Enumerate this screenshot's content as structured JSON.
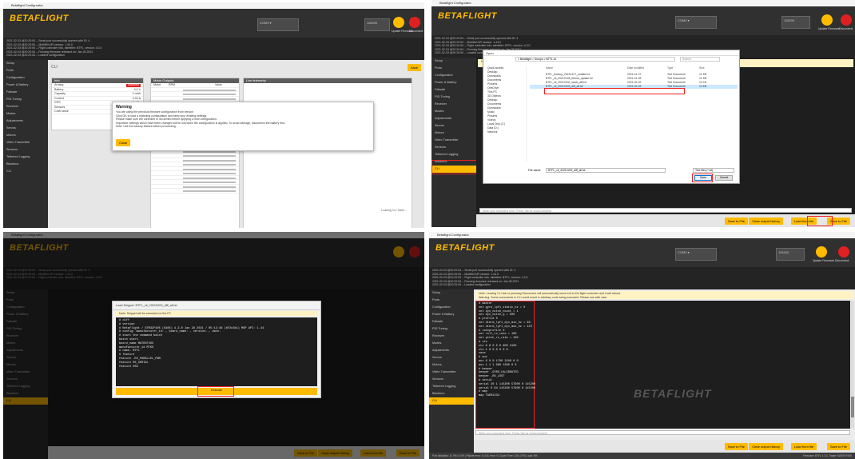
{
  "common": {
    "brand": "BETAFLIGHT",
    "window_title": "Betaflight Configurator",
    "update_label": "Update Firmware",
    "disconnect_label": "Disconnect",
    "colors": {
      "accent": "#ffbb00",
      "header": "#303030",
      "update": "#ffbb00",
      "disconnect": "#e02020"
    },
    "icons": [
      "usb-icon",
      "gear-icon",
      "plug-icon",
      "folder-icon"
    ]
  },
  "panel1": {
    "log_lines": [
      "2021-02-03 @20:20:54 -- Serial port successfully opened with ID: 4",
      "2021-02-03 @20:20:54 -- MultiWii API version: 1.44.0",
      "2021-02-03 @20:20:54 -- Flight controller info, identifier: BTFL, version: 4.3.0",
      "2021-02-03 @20:20:54 -- Running firmware released on: Jan 28 2021",
      "2021-02-03 @20:20:54 -- Loaded configuration"
    ],
    "sidebar": [
      "Setup",
      "Ports",
      "Configuration",
      "Power & Battery",
      "Failsafe",
      "PID Tuning",
      "Receiver",
      "Modes",
      "Adjustments",
      "Servos",
      "Motors",
      "Video Transmitter",
      "Sensors",
      "Tethered Logging",
      "Blackbox",
      "CLI"
    ],
    "section_title": "CLI",
    "top_button": "Save",
    "left_table_title": "Info",
    "left_table_rows": [
      [
        "Arming",
        "Disabled"
      ],
      [
        "Battery",
        "0.0 V"
      ],
      [
        "Capacity",
        "0 mAh"
      ],
      [
        "Current",
        "0.00 A"
      ],
      [
        "GPS",
        "No Fix"
      ],
      [
        "Sensors",
        "OK"
      ],
      [
        "Craft name",
        ""
      ]
    ],
    "mid_table_title": "Motor Outputs",
    "mid_table_head": [
      "Motor",
      "RPM",
      "Value"
    ],
    "right_table_title": "Live telemetry",
    "dialog": {
      "title": "Warning",
      "line1": "You are using the previous firmware configuration from version",
      "line2": "Click OK to load a matching configuration and keep your existing settings.",
      "line3": "Please make sure the controller is not armed before applying a new configuration.",
      "line4": "Important: settings which have been changed will be lost when the configuration is applied. To avoid damage, disconnect the battery first.",
      "line5": "Note: Use the backup feature before proceeding.",
      "button": "Close"
    },
    "bottom_right_label": "Loading CLI Table..."
  },
  "panel2": {
    "sidebar": [
      "Setup",
      "Ports",
      "Configuration",
      "Power & Battery",
      "Failsafe",
      "PID Tuning",
      "Receiver",
      "Modes",
      "Adjustments",
      "Servos",
      "Motors",
      "Video Transmitter",
      "Sensors",
      "Tethered Logging",
      "Blackbox",
      "CLI"
    ],
    "file_dialog": {
      "title": "Open",
      "path": "> Betaflight > Dumps > BTFL cli",
      "search": "Search",
      "nav": [
        "Quick access",
        "Desktop",
        "Downloads",
        "Documents",
        "Pictures",
        "OneDrive",
        "This PC",
        "3D Objects",
        "Desktop",
        "Documents",
        "Downloads",
        "Music",
        "Pictures",
        "Videos",
        "Local Disk (C:)",
        "Data (D:)",
        "Network"
      ],
      "columns": [
        "Name",
        "Date modified",
        "Type",
        "Size"
      ],
      "files": [
        [
          "BTFL_backup_20210127_nodate.txt",
          "2021-01-27",
          "Text Document",
          "12 KB"
        ],
        [
          "BTFL_cli_20210128_before_update.txt",
          "2021-01-28",
          "Text Document",
          "12 KB"
        ],
        [
          "BTFL_cli_20210202_stock_diff.txt",
          "2021-02-02",
          "Text Document",
          "11 KB"
        ],
        [
          "BTFL_cli_20210203_diff_all.txt",
          "2021-02-03",
          "Text Document",
          "12 KB"
        ]
      ],
      "filename_label": "File name:",
      "filename_value": "BTFL_cli_20210203_diff_all.txt",
      "filter": "Text files (*.txt)",
      "open_button": "Open",
      "cancel_button": "Cancel"
    },
    "left_list": [
      "Name",
      "Betaflight backup",
      "Dumps"
    ],
    "bottom_buttons": [
      "Save to File",
      "Clear output history",
      "Load from file",
      "Save to File"
    ],
    "input_placeholder": "Write your command here. Press Tab for AutoComplete."
  },
  "panel3": {
    "sidebar": [
      "Setup",
      "Ports",
      "Configuration",
      "Power & Battery",
      "Failsafe",
      "PID Tuning",
      "Receiver",
      "Modes",
      "Adjustments",
      "Servos",
      "Motors",
      "Video Transmitter",
      "Sensors",
      "Tethered Logging",
      "Blackbox",
      "CLI"
    ],
    "dialog_title": "Load Snippet: BTFL_cli_20210203_diff_all.txt",
    "dialog_note": "Note: Snippet will be executed on the FC",
    "lines": [
      "# diff",
      "# version",
      "# Betaflight / STM32F405 (S405) 4.3.0 Jan 28 2021 / 05:12:46 (6f2c3b1) MSP API: 1.44",
      "# config: manufacturer_id: , board_name: , version: , date: ",
      "# start the command batch",
      "batch start",
      "board_name MATEKF405",
      "manufacturer_id MTKS",
      "# name: BTFL",
      "",
      "# feature",
      "feature -RX_PARALLEL_PWM",
      "feature RX_SERIAL",
      "feature OSD"
    ],
    "execute_button": "Execute",
    "bottom_buttons": [
      "Save to File",
      "Clear output history",
      "Load from file",
      "Save to File"
    ]
  },
  "panel4": {
    "sidebar": [
      "Setup",
      "Ports",
      "Configuration",
      "Power & Battery",
      "Failsafe",
      "PID Tuning",
      "Receiver",
      "Modes",
      "Adjustments",
      "Servos",
      "Motors",
      "Video Transmitter",
      "Sensors",
      "Tethered Logging",
      "Blackbox",
      "CLI"
    ],
    "warn_line1": "Note: Leaving CLI tab or pressing Disconnect will automatically send exit to the flight controller and it will reboot.",
    "warn_line2": "Warning: Some commands in CLI could result in arbitrary code being executed. Please use with care.",
    "cli_lines": [
      "# master",
      "set gyro_lpf1_static_hz = 0",
      "set dyn_notch_count = 1",
      "set dyn_notch_q = 500",
      "",
      "# profile 0",
      "set dterm_lpf1_dyn_min_hz = 63",
      "set dterm_lpf1_dyn_max_hz = 125",
      "",
      "# rateprofile 0",
      "set roll_rc_rate = 100",
      "set pitch_rc_rate = 100",
      "",
      "# vtx",
      "vtx 0 6 0 0 0 900 2100",
      "vtx 1 0 0 0 0 0 0",
      "",
      "save",
      "",
      "# aux",
      "aux 0 0 0 1700 2100 0 0",
      "aux 1 1 1 900 1300 0 0",
      "",
      "# beeper",
      "beeper -GYRO_CALIBRATED",
      "beeper -RX_LOST",
      "",
      "# serial",
      "serial 20 1 115200 57600 0 115200",
      "serial 0 64 115200 57600 0 115200",
      "",
      "# map",
      "map TAER1234"
    ],
    "watermark": "BETAFLIGHT",
    "input_placeholder": "Write your command here. Press Tab for AutoComplete.",
    "bottom_buttons": [
      "Save to File",
      "Clear output history",
      "Load from file",
      "Save to File"
    ],
    "status_bar": "Port utilization: D: 0% U: 0% | Packet error: 0 | I2C error: 0 | Cycle Time: 125 | CPU Load: 8%",
    "status_right": "Firmware: BTFL 4.3.0, Target: MATEKF405"
  }
}
